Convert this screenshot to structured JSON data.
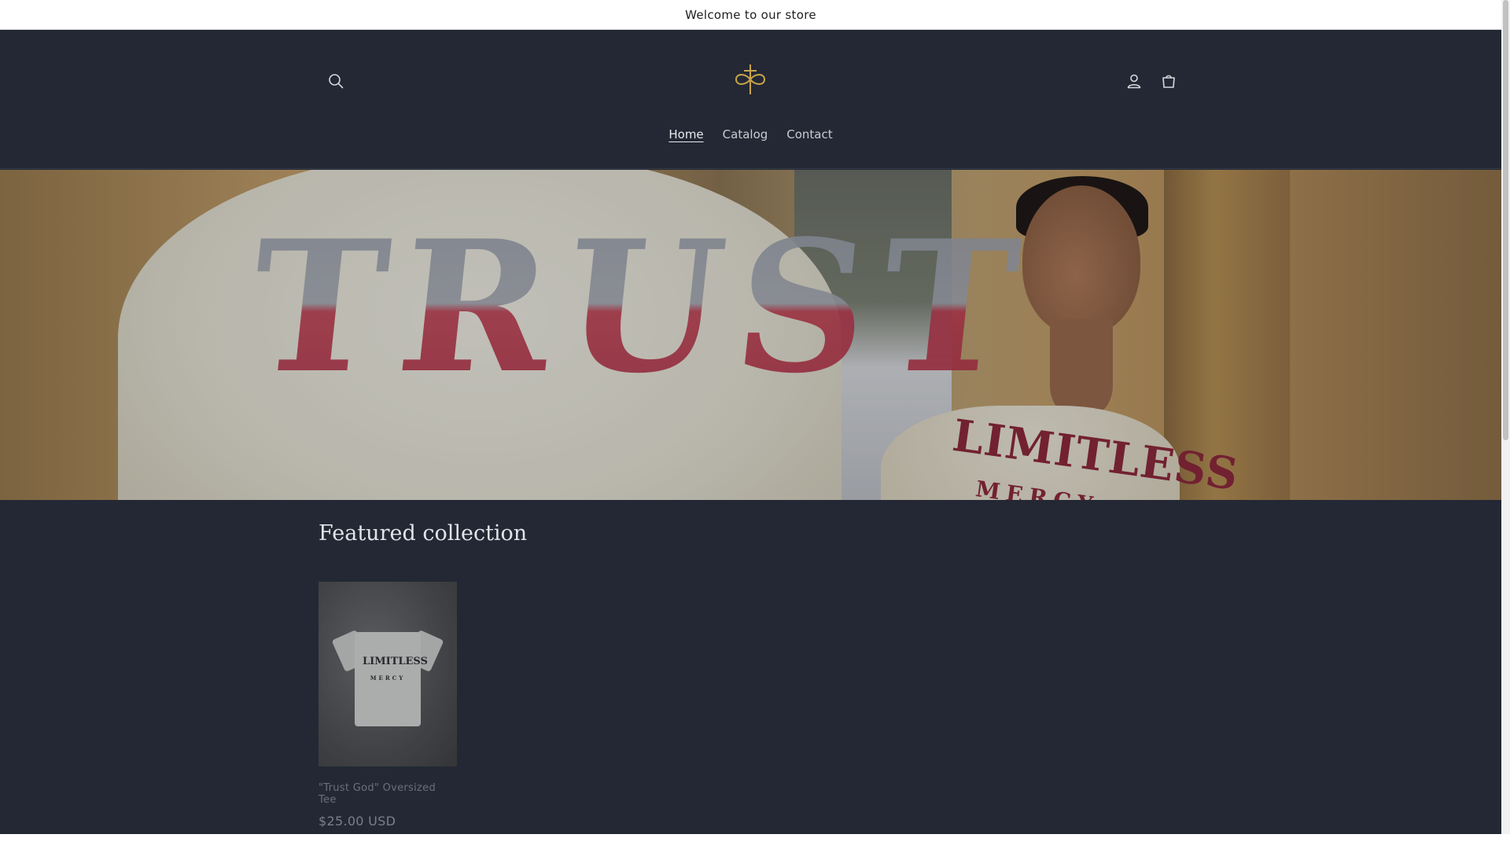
{
  "announcement": {
    "text": "Welcome to our store"
  },
  "header": {
    "search_icon": "search-icon",
    "logo_icon": "cross-infinity-logo",
    "account_icon": "account-icon",
    "cart_icon": "cart-icon"
  },
  "nav": {
    "items": [
      {
        "label": "Home",
        "active": true
      },
      {
        "label": "Catalog",
        "active": false
      },
      {
        "label": "Contact",
        "active": false
      }
    ]
  },
  "hero": {
    "shirt_back_text": "TRUST",
    "shirt_front_text": "LIMITLESS",
    "shirt_front_subtext": "MERCY"
  },
  "featured": {
    "title": "Featured collection",
    "products": [
      {
        "name": "\"Trust God\" Oversized Tee",
        "price": "$25.00 USD",
        "print": "LIMITLESS",
        "print_sub": "MERCY"
      }
    ]
  },
  "colors": {
    "background": "#232834",
    "announcement_bg": "#ffffff",
    "logo_gold": "#c9a44a",
    "text_light": "#e2e4e9"
  }
}
